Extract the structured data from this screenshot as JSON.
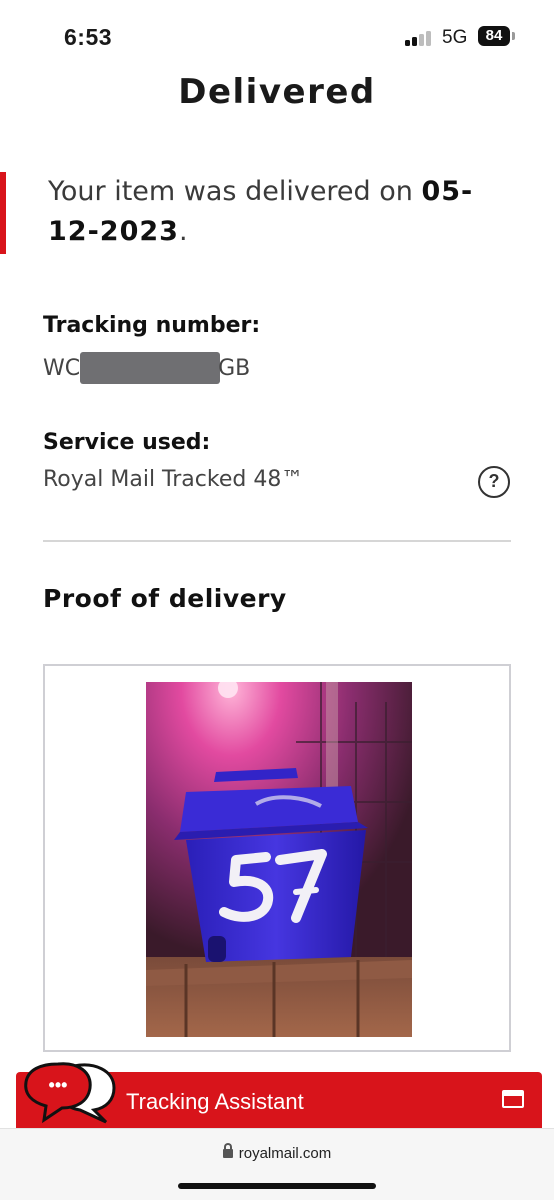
{
  "status_bar": {
    "time": "6:53",
    "network": "5G",
    "battery": "84"
  },
  "page": {
    "title": "Delivered"
  },
  "delivery": {
    "message_prefix": "Your item was delivered on ",
    "date": "05-12-2023",
    "message_suffix": "."
  },
  "tracking": {
    "label": "Tracking number:",
    "value_start": "WC",
    "value_end": "GB"
  },
  "service": {
    "label": "Service used:",
    "value": "Royal Mail Tracked 48™",
    "help_icon": "question-circle-icon"
  },
  "proof": {
    "title": "Proof of delivery",
    "photo_number": "57"
  },
  "assistant": {
    "label": "Tracking Assistant",
    "icon": "chat-bubble-icon",
    "dots": "•••"
  },
  "browser": {
    "url": "royalmail.com"
  },
  "colors": {
    "brand_red": "#d8141b",
    "bin_blue": "#3b2bd1"
  }
}
